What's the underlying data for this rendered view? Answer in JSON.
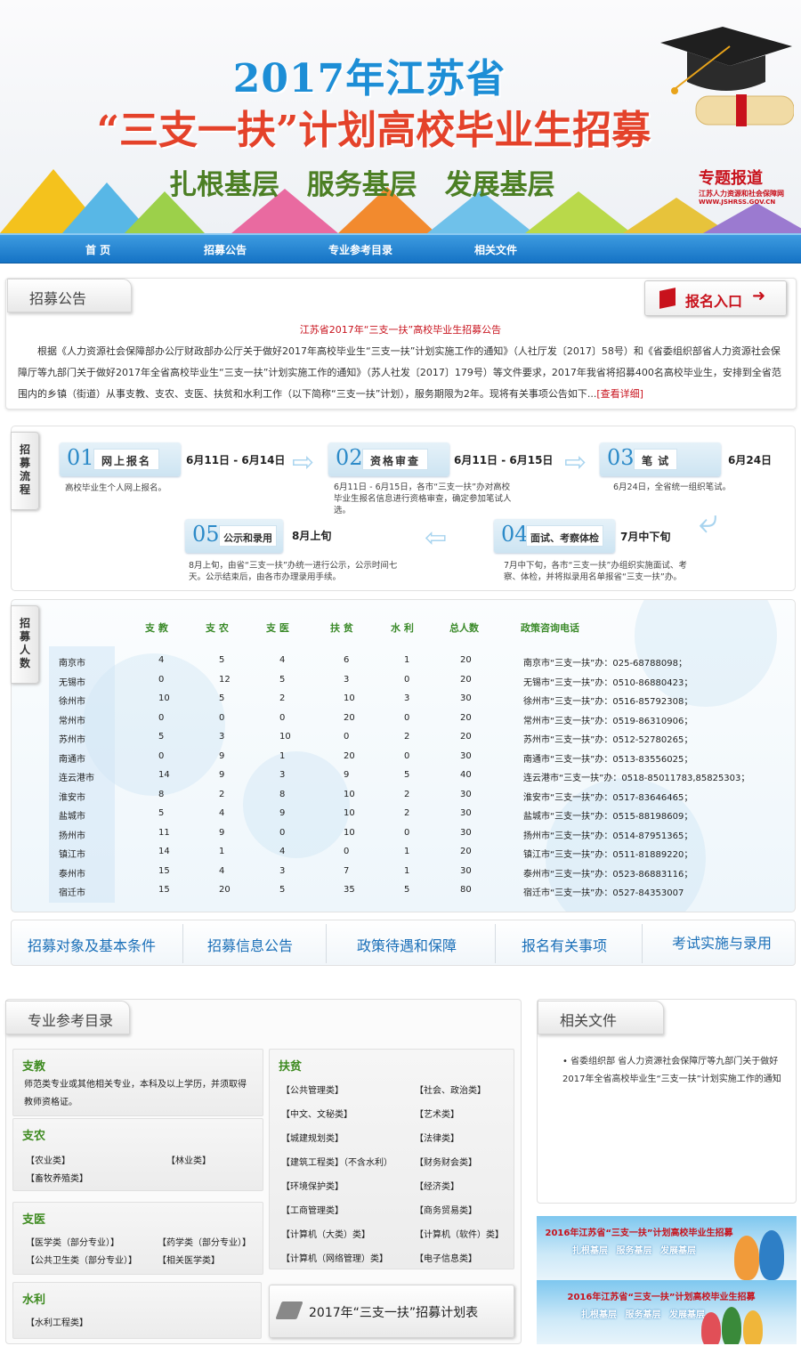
{
  "banner": {
    "line1": "2017年江苏省",
    "line2": "“三支一扶”计划高校毕业生招募",
    "line3": "扎根基层  服务基层  发展基层",
    "badge_title": "专题报道",
    "badge_org": "江苏人力资源和社会保障网",
    "badge_url": "WWW.JSHRSS.GOV.CN"
  },
  "nav": [
    "首 页",
    "招募公告",
    "专业参考目录",
    "相关文件"
  ],
  "notice": {
    "tab": "招募公告",
    "register": "报名入口",
    "title": "江苏省2017年“三支一扶”高校毕业生招募公告",
    "body": "根据《人力资源社会保障部办公厅财政部办公厅关于做好2017年高校毕业生“三支一扶”计划实施工作的通知》（人社厅发〔2017〕58号）和《省委组织部省人力资源社会保障厅等九部门关于做好2017年全省高校毕业生“三支一扶”计划实施工作的通知》（苏人社发〔2017〕179号）等文件要求，2017年我省将招募400名高校毕业生，安排到全省范围内的乡镇（街道）从事支教、支农、支医、扶贫和水利工作（以下简称“三支一扶”计划），服务期限为2年。现将有关事项公告如下...",
    "more": "[查看详细]"
  },
  "process": {
    "tab": "招募流程",
    "steps": [
      {
        "num": "01",
        "label": "网上报名",
        "date": "6月11日 - 6月14日",
        "desc": "高校毕业生个人网上报名。"
      },
      {
        "num": "02",
        "label": "资格审查",
        "date": "6月11日 - 6月15日",
        "desc": "6月11日 - 6月15日，各市“三支一扶”办对高校毕业生报名信息进行资格审查，确定参加笔试人选。"
      },
      {
        "num": "03",
        "label": "笔    试",
        "date": "6月24日",
        "desc": "6月24日，全省统一组织笔试。"
      },
      {
        "num": "04",
        "label": "面试、考察体检",
        "date": "7月中下旬",
        "desc": "7月中下旬，各市“三支一扶”办组织实施面试、考察、体检，并将拟录用名单报省“三支一扶”办。"
      },
      {
        "num": "05",
        "label": "公示和录用",
        "date": "8月上旬",
        "desc": "8月上旬，由省“三支一扶”办统一进行公示，公示时间七天。公示结束后，由各市办理录用手续。"
      }
    ]
  },
  "numbers": {
    "tab": "招募人数",
    "headers": [
      "支 教",
      "支 农",
      "支 医",
      "扶 贫",
      "水 利",
      "总人数",
      "政策咨询电话"
    ],
    "rows": [
      [
        "南京市",
        "4",
        "5",
        "4",
        "6",
        "1",
        "20",
        "南京市“三支一扶”办：025-68788098；"
      ],
      [
        "无锡市",
        "0",
        "12",
        "5",
        "3",
        "0",
        "20",
        "无锡市“三支一扶”办：0510-86880423；"
      ],
      [
        "徐州市",
        "10",
        "5",
        "2",
        "10",
        "3",
        "30",
        "徐州市“三支一扶”办：0516-85792308；"
      ],
      [
        "常州市",
        "0",
        "0",
        "0",
        "20",
        "0",
        "20",
        "常州市“三支一扶”办：0519-86310906；"
      ],
      [
        "苏州市",
        "5",
        "3",
        "10",
        "0",
        "2",
        "20",
        "苏州市“三支一扶”办：0512-52780265；"
      ],
      [
        "南通市",
        "0",
        "9",
        "1",
        "20",
        "0",
        "30",
        "南通市“三支一扶”办：0513-83556025；"
      ],
      [
        "连云港市",
        "14",
        "9",
        "3",
        "9",
        "5",
        "40",
        "连云港市“三支一扶”办：0518-85011783,85825303；"
      ],
      [
        "淮安市",
        "8",
        "2",
        "8",
        "10",
        "2",
        "30",
        "淮安市“三支一扶”办：0517-83646465；"
      ],
      [
        "盐城市",
        "5",
        "4",
        "9",
        "10",
        "2",
        "30",
        "盐城市“三支一扶”办：0515-88198609；"
      ],
      [
        "扬州市",
        "11",
        "9",
        "0",
        "10",
        "0",
        "30",
        "扬州市“三支一扶”办：0514-87951365；"
      ],
      [
        "镇江市",
        "14",
        "1",
        "4",
        "0",
        "1",
        "20",
        "镇江市“三支一扶”办：0511-81889220；"
      ],
      [
        "泰州市",
        "15",
        "4",
        "3",
        "7",
        "1",
        "30",
        "泰州市“三支一扶”办：0523-86883116；"
      ],
      [
        "宿迁市",
        "15",
        "20",
        "5",
        "35",
        "5",
        "80",
        "宿迁市“三支一扶”办：0527-84353007"
      ]
    ]
  },
  "tabs": [
    "招募对象及基本条件",
    "招募信息公告",
    "政策待遇和保障",
    "报名有关事项",
    "考试实施与录用"
  ],
  "catalog": {
    "tab": "专业参考目录",
    "zhijiao": {
      "title": "支教",
      "text1": "师范类专业或其他相关专业，本科及以上学历，并须取得",
      "text2": "教师资格证。"
    },
    "zhinong": {
      "title": "支农",
      "items": [
        "【农业类】",
        "【林业类】",
        "【畜牧养殖类】"
      ]
    },
    "zhiyi": {
      "title": "支医",
      "items": [
        "【医学类（部分专业）】",
        "【药学类（部分专业）】",
        "【公共卫生类（部分专业）】",
        "【相关医学类】"
      ]
    },
    "shuili": {
      "title": "水利",
      "items": [
        "【水利工程类】"
      ]
    },
    "fupin": {
      "title": "扶贫",
      "items": [
        "【公共管理类】",
        "【社会、政治类】",
        "【中文、文秘类】",
        "【艺术类】",
        "【城建规划类】",
        "【法律类】",
        "【建筑工程类】（不含水利）",
        "【财务财会类】",
        "【环境保护类】",
        "【经济类】",
        "【工商管理类】",
        "【商务贸易类】",
        "【计算机（大类）类】",
        "【计算机（软件）类】",
        "【计算机（网络管理）类】",
        "【电子信息类】"
      ]
    },
    "plan": "2017年“三支一扶”招募计划表"
  },
  "related": {
    "tab": "相关文件",
    "text": "省委组织部 省人力资源社会保障厅等九部门关于做好2017年全省高校毕业生“三支一扶”计划实施工作的通知"
  },
  "ads": [
    {
      "title": "2016年江苏省“三支一扶”计划高校毕业生招募",
      "slogan": "扎根基层 服务基层 发展基层"
    },
    {
      "title": "2016年江苏省“三支一扶”计划高校毕业生招募",
      "slogan": "扎根基层 服务基层 发展基层"
    }
  ],
  "colors": {
    "accent_red": "#c8121c",
    "nav_blue": "#1573c5",
    "title_blue": "#1d8ed6",
    "green": "#3d8a1f"
  }
}
